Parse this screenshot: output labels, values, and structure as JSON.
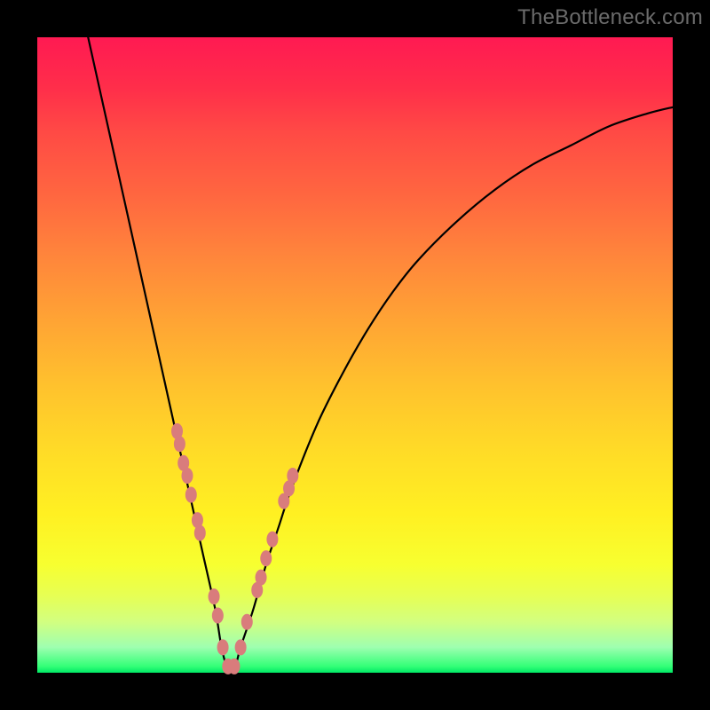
{
  "watermark": "TheBottleneck.com",
  "colors": {
    "frame": "#000000",
    "gradient_top": "#ff1a52",
    "gradient_bottom": "#00e865",
    "curve": "#000000",
    "marker": "#d97c7c"
  },
  "chart_data": {
    "type": "line",
    "title": "",
    "xlabel": "",
    "ylabel": "",
    "xlim": [
      0,
      100
    ],
    "ylim": [
      0,
      100
    ],
    "x_min_point": 30,
    "series": [
      {
        "name": "bottleneck-curve",
        "x": [
          8,
          10,
          12,
          14,
          16,
          18,
          20,
          22,
          24,
          26,
          28,
          29,
          30,
          31,
          32,
          34,
          36,
          38,
          40,
          44,
          48,
          52,
          56,
          60,
          66,
          72,
          78,
          84,
          90,
          96,
          100
        ],
        "y": [
          100,
          91,
          82,
          73,
          64,
          55,
          46,
          37,
          28,
          19,
          10,
          4,
          0.5,
          0.5,
          4,
          10,
          17,
          23,
          29,
          39,
          47,
          54,
          60,
          65,
          71,
          76,
          80,
          83,
          86,
          88,
          89
        ]
      }
    ],
    "markers": {
      "name": "data-points",
      "x": [
        22,
        22.4,
        23,
        23.6,
        24.2,
        25.2,
        25.6,
        27.8,
        28.4,
        29.2,
        30,
        31,
        32,
        33,
        34.6,
        35.2,
        36,
        37,
        38.8,
        39.6,
        40.2
      ],
      "y": [
        38,
        36,
        33,
        31,
        28,
        24,
        22,
        12,
        9,
        4,
        1,
        1,
        4,
        8,
        13,
        15,
        18,
        21,
        27,
        29,
        31
      ]
    }
  }
}
